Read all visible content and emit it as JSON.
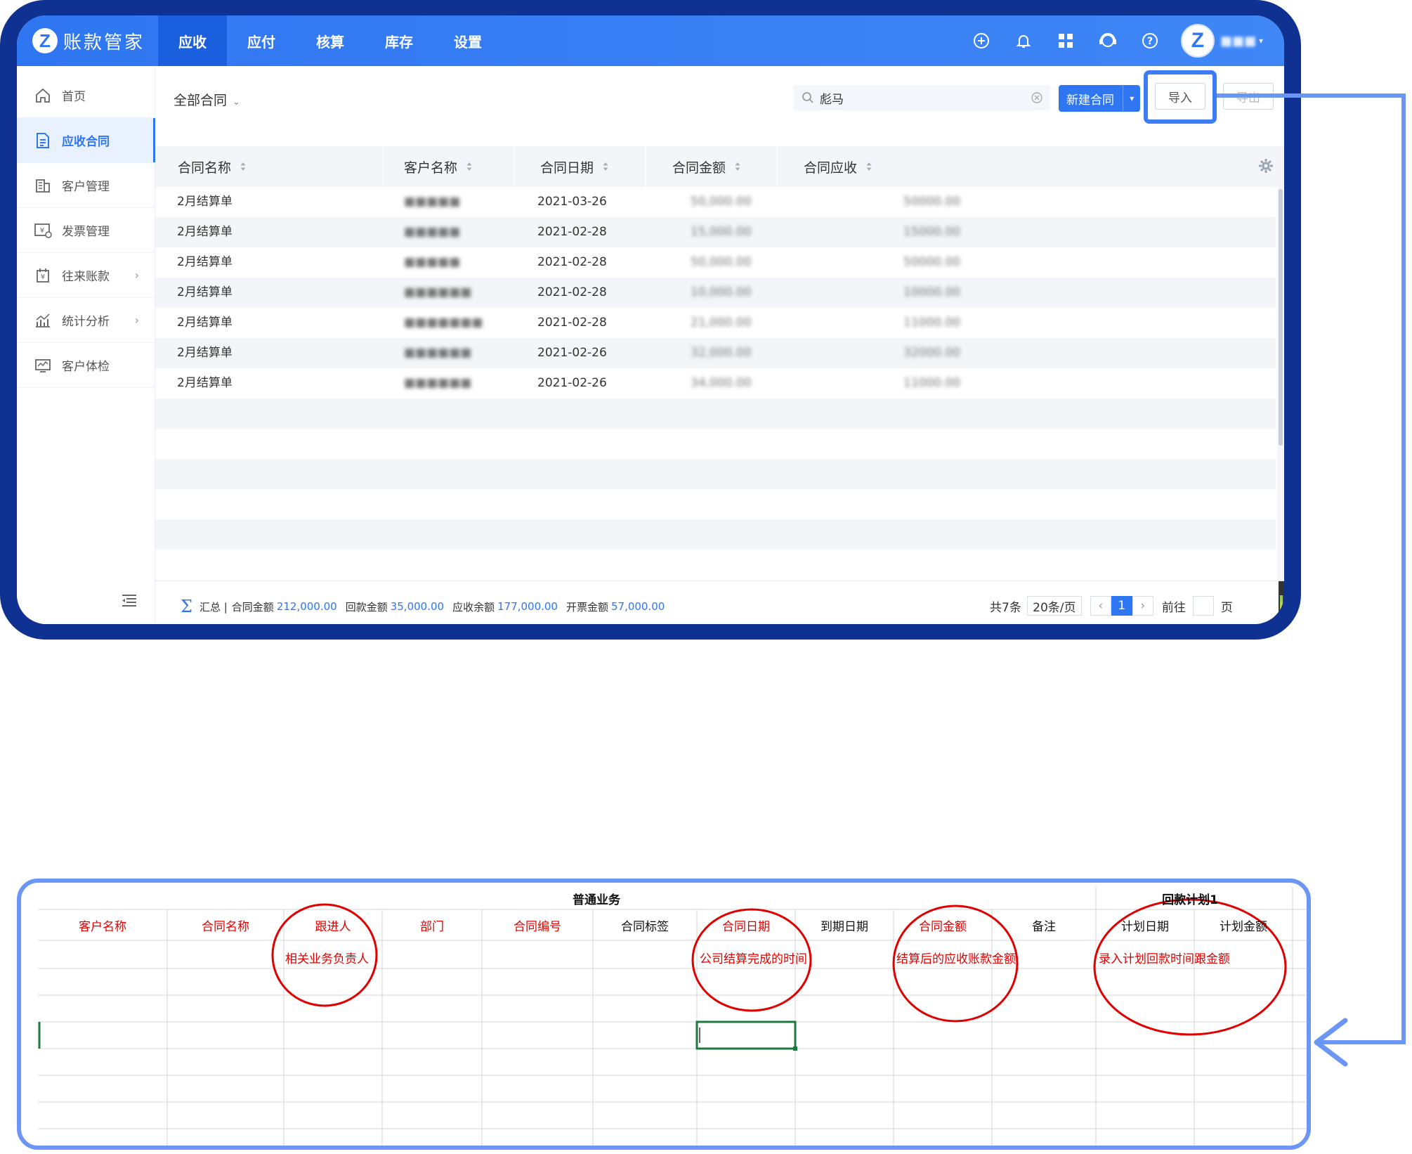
{
  "app": {
    "logo_letter": "Z",
    "name": "账款管家",
    "nav": [
      "应收",
      "应付",
      "核算",
      "库存",
      "设置"
    ],
    "active_nav": "应收",
    "top_icons": [
      "add-icon",
      "bell-icon",
      "apps-icon",
      "support-icon",
      "help-icon"
    ],
    "avatar_letter": "Z",
    "user_name": "■■■"
  },
  "sidebar": {
    "items": [
      {
        "label": "首页",
        "icon": "home-icon"
      },
      {
        "label": "应收合同",
        "icon": "document-icon",
        "active": true
      },
      {
        "label": "客户管理",
        "icon": "building-icon"
      },
      {
        "label": "发票管理",
        "icon": "invoice-icon"
      },
      {
        "label": "往来账款",
        "icon": "ledger-icon",
        "expandable": true
      },
      {
        "label": "统计分析",
        "icon": "chart-icon",
        "expandable": true
      },
      {
        "label": "客户体检",
        "icon": "monitor-icon"
      }
    ]
  },
  "toolbar": {
    "filter": "全部合同",
    "search_value": "彪马",
    "new_button": "新建合同",
    "import_button": "导入",
    "export_button": "导出"
  },
  "table": {
    "columns": [
      "合同名称",
      "客户名称",
      "合同日期",
      "合同金额",
      "合同应收"
    ],
    "rows": [
      {
        "name": "2月结算单",
        "customer": "■■■■■",
        "date": "2021-03-26",
        "amount": "50,000.00",
        "receivable": "50000.00"
      },
      {
        "name": "2月结算单",
        "customer": "■■■■■",
        "date": "2021-02-28",
        "amount": "15,000.00",
        "receivable": "15000.00"
      },
      {
        "name": "2月结算单",
        "customer": "■■■■■",
        "date": "2021-02-28",
        "amount": "50,000.00",
        "receivable": "50000.00"
      },
      {
        "name": "2月结算单",
        "customer": "■■■■■■",
        "date": "2021-02-28",
        "amount": "10,000.00",
        "receivable": "10000.00"
      },
      {
        "name": "2月结算单",
        "customer": "■■■■■■■",
        "date": "2021-02-28",
        "amount": "21,000.00",
        "receivable": "11000.00"
      },
      {
        "name": "2月结算单",
        "customer": "■■■■■■",
        "date": "2021-02-26",
        "amount": "32,000.00",
        "receivable": "32000.00"
      },
      {
        "name": "2月结算单",
        "customer": "■■■■■■",
        "date": "2021-02-26",
        "amount": "34,000.00",
        "receivable": "11000.00"
      }
    ]
  },
  "summary": {
    "label": "汇总 |",
    "items": [
      {
        "label": "合同金额",
        "value": "212,000.00"
      },
      {
        "label": "回款金额",
        "value": "35,000.00"
      },
      {
        "label": "应收余额",
        "value": "177,000.00"
      },
      {
        "label": "开票金额",
        "value": "57,000.00"
      }
    ]
  },
  "pager": {
    "total": "共7条",
    "page_size": "20条/页",
    "current": "1",
    "goto_prefix": "前往",
    "goto_suffix": "页"
  },
  "sheet": {
    "group_title": "普通业务",
    "plan_title": "回款计划1",
    "headers": [
      {
        "text": "客户名称",
        "color": "red"
      },
      {
        "text": "合同名称",
        "color": "red"
      },
      {
        "text": "跟进人",
        "color": "red"
      },
      {
        "text": "部门",
        "color": "red"
      },
      {
        "text": "合同编号",
        "color": "red"
      },
      {
        "text": "合同标签",
        "color": "black"
      },
      {
        "text": "合同日期",
        "color": "red"
      },
      {
        "text": "到期日期",
        "color": "black"
      },
      {
        "text": "合同金额",
        "color": "red"
      },
      {
        "text": "备注",
        "color": "black"
      },
      {
        "text": "计划日期",
        "color": "black"
      },
      {
        "text": "计划金额",
        "color": "black"
      }
    ],
    "notes": {
      "follower": "相关业务负责人",
      "contract_date": "公司结算完成的时间",
      "contract_amount": "结算后的应收账款金额",
      "plan": "录入计划回款时间跟金额"
    },
    "annotation_color": "#e00000"
  },
  "colors": {
    "brand": "#2f76f2",
    "frame": "#0f3191",
    "highlight": "#3c7cf6"
  }
}
